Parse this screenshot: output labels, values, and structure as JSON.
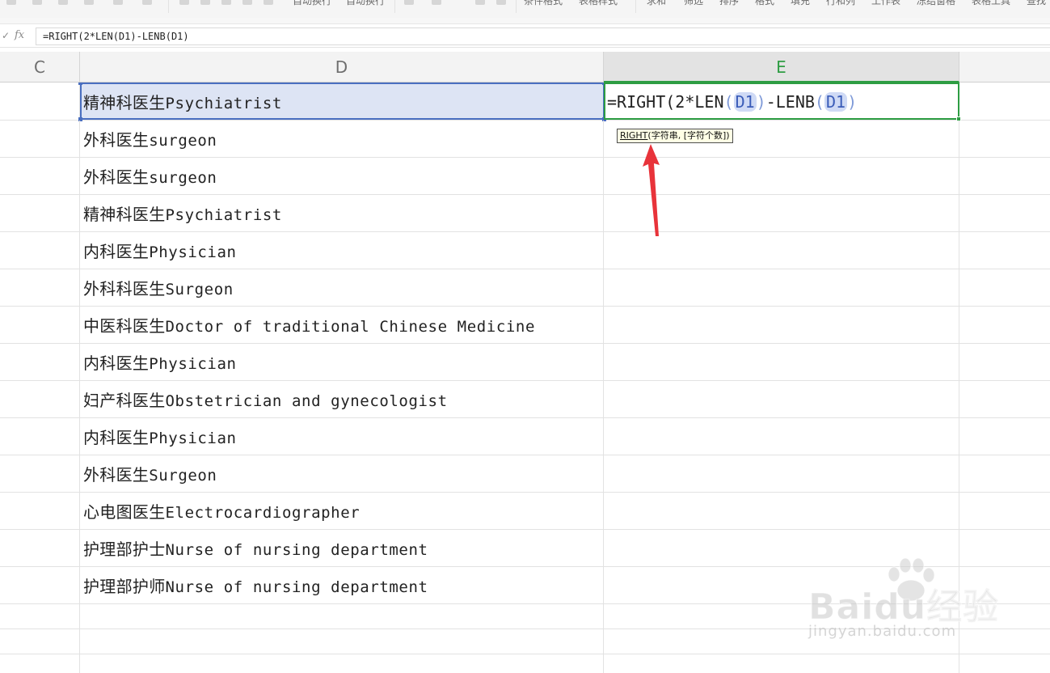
{
  "ribbon": {
    "labels": [
      "自动换行",
      "条件格式",
      "表格样式",
      "求和",
      "筛选",
      "排序",
      "格式",
      "填充",
      "行和列",
      "工作表",
      "冻结窗格",
      "表格工具",
      "查找"
    ]
  },
  "formula_bar": {
    "check_glyph": "✓",
    "fx_label": "fx",
    "formula": "=RIGHT(2*LEN(D1)-LENB(D1)"
  },
  "columns": [
    "C",
    "D",
    "E"
  ],
  "rows": [
    {
      "cn": "精神科医生",
      "en": "Psychiatrist"
    },
    {
      "cn": "外科医生",
      "en": "surgeon"
    },
    {
      "cn": "外科医生",
      "en": "surgeon"
    },
    {
      "cn": "精神科医生",
      "en": "Psychiatrist"
    },
    {
      "cn": "内科医生",
      "en": "Physician"
    },
    {
      "cn": "外科科医生",
      "en": "Surgeon"
    },
    {
      "cn": "中医科医生",
      "en": "Doctor of traditional Chinese Medicine"
    },
    {
      "cn": "内科医生",
      "en": "Physician"
    },
    {
      "cn": "妇产科医生",
      "en": "Obstetrician and gynecologist"
    },
    {
      "cn": "内科医生",
      "en": "Physician"
    },
    {
      "cn": "外科医生",
      "en": "Surgeon"
    },
    {
      "cn": "心电图医生",
      "en": "Electrocardiographer"
    },
    {
      "cn": "护理部护士",
      "en": "Nurse of nursing department"
    },
    {
      "cn": "护理部护师",
      "en": "Nurse of nursing department"
    }
  ],
  "active_cell": {
    "formula_parts": {
      "p1": "=RIGHT",
      "p2": "(",
      "p3": "2*LEN",
      "p4": "(",
      "p5": "D1",
      "p6": ")",
      "p7": "-LENB",
      "p8": "(",
      "p9": "D1",
      "p10": ")"
    }
  },
  "tooltip": {
    "fn": "RIGHT",
    "args": "(字符串, [字符个数])"
  },
  "watermark": {
    "logo": "Baidu经验",
    "url": "jingyan.baidu.com"
  },
  "colors": {
    "accent_green": "#2e9d43",
    "selection_blue": "#4a6fc0",
    "arrow_red": "#e8333a"
  }
}
